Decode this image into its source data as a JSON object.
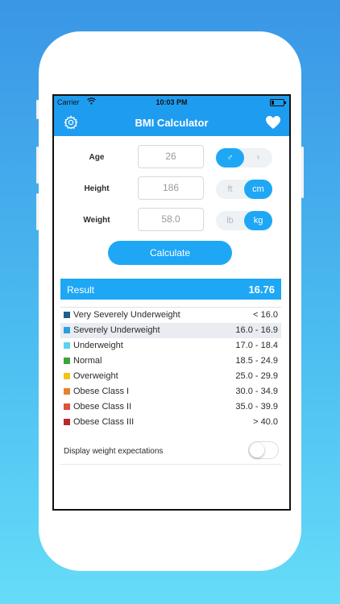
{
  "status_bar": {
    "carrier": "Carrier",
    "time": "10:03 PM"
  },
  "nav": {
    "title": "BMI Calculator",
    "left_icon": "gear-icon",
    "right_icon": "heart-icon"
  },
  "form": {
    "age": {
      "label": "Age",
      "value": "26",
      "gender_options": [
        "♂",
        "♀"
      ],
      "selected": "♂"
    },
    "height": {
      "label": "Height",
      "value": "186",
      "unit_options": [
        "ft",
        "cm"
      ],
      "selected": "cm"
    },
    "weight": {
      "label": "Weight",
      "value": "58.0",
      "unit_options": [
        "lb",
        "kg"
      ],
      "selected": "kg"
    }
  },
  "calculate_label": "Calculate",
  "result": {
    "label": "Result",
    "value": "16.76"
  },
  "categories": [
    {
      "name": "Very Severely Underweight",
      "range": "< 16.0",
      "color": "#1f5f8f"
    },
    {
      "name": "Severely Underweight",
      "range": "16.0 - 16.9",
      "color": "#2b9fe0",
      "highlighted": true
    },
    {
      "name": "Underweight",
      "range": "17.0 - 18.4",
      "color": "#5cd2f0"
    },
    {
      "name": "Normal",
      "range": "18.5 - 24.9",
      "color": "#3aa53a"
    },
    {
      "name": "Overweight",
      "range": "25.0 - 29.9",
      "color": "#f0c419"
    },
    {
      "name": "Obese Class I",
      "range": "30.0 - 34.9",
      "color": "#e8812c"
    },
    {
      "name": "Obese Class II",
      "range": "35.0 - 39.9",
      "color": "#e0503a"
    },
    {
      "name": "Obese Class III",
      "range": "> 40.0",
      "color": "#b8282e"
    }
  ],
  "display_weight_expectations": {
    "label": "Display weight expectations",
    "enabled": false
  },
  "colors": {
    "accent": "#1ea7f5",
    "nav": "#1e9cf0",
    "highlight_row": "#e9edf1"
  }
}
